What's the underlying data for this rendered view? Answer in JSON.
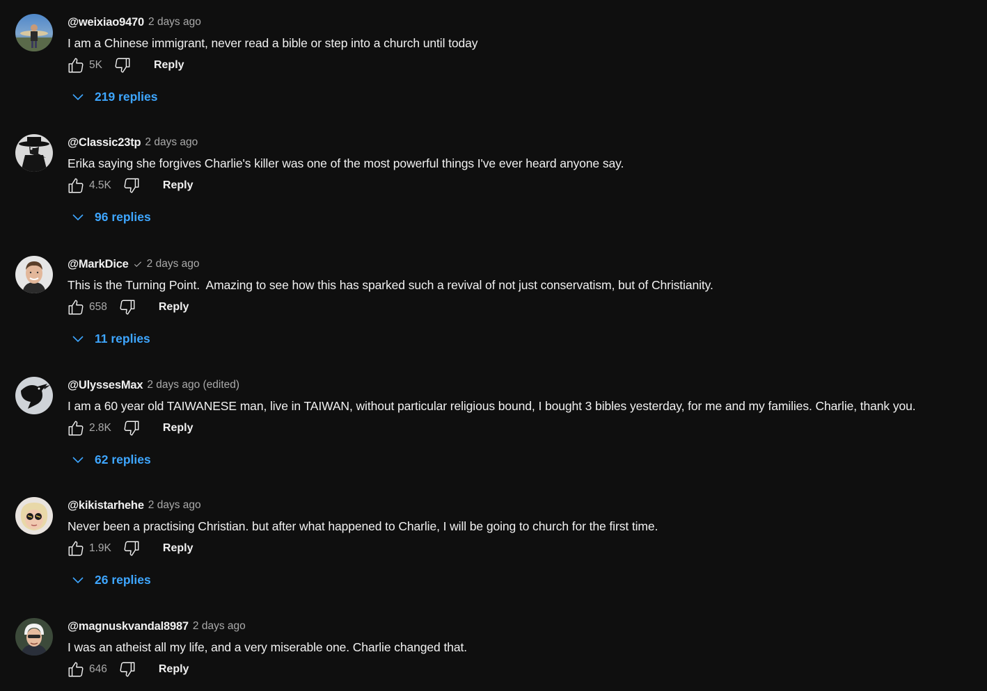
{
  "colors": {
    "background": "#0f0f0f",
    "text": "#f1f1f1",
    "secondary_text": "#aaaaaa",
    "link_blue": "#3ea6ff"
  },
  "comments": [
    {
      "author": "@weixiao9470",
      "time": "2 days ago",
      "verified": false,
      "text": "I am a Chinese immigrant, never read a bible or step into a church until today",
      "likes": "5K",
      "reply_label": "Reply",
      "replies_label": "219 replies",
      "avatar": "fisherman-photo"
    },
    {
      "author": "@Classic23tp",
      "time": "2 days ago",
      "verified": false,
      "text": "Erika saying she forgives Charlie's killer was one of the most powerful things I've ever heard anyone say.",
      "likes": "4.5K",
      "reply_label": "Reply",
      "replies_label": "96 replies",
      "avatar": "plague-doctor-photo"
    },
    {
      "author": "@MarkDice",
      "time": "2 days ago",
      "verified": true,
      "text": "This is the Turning Point.  Amazing to see how this has sparked such a revival of not just conservatism, but of Christianity.",
      "likes": "658",
      "reply_label": "Reply",
      "replies_label": "11 replies",
      "avatar": "man-portrait-photo"
    },
    {
      "author": "@UlyssesMax",
      "time": "2 days ago (edited)",
      "verified": false,
      "text": "I am a 60 year old TAIWANESE man, live in TAIWAN, without particular religious bound, I bought 3 bibles yesterday, for me and my families. Charlie, thank you.",
      "likes": "2.8K",
      "reply_label": "Reply",
      "replies_label": "62 replies",
      "avatar": "crow-photo"
    },
    {
      "author": "@kikistarhehe",
      "time": "2 days ago",
      "verified": false,
      "text": "Never been a practising Christian. but after what happened to Charlie, I will be going to church for the first time.",
      "likes": "1.9K",
      "reply_label": "Reply",
      "replies_label": "26 replies",
      "avatar": "blonde-sunglasses-photo"
    },
    {
      "author": "@magnuskvandal8987",
      "time": "2 days ago",
      "verified": false,
      "text": "I was an atheist all my life, and a very miserable one. Charlie changed that.",
      "likes": "646",
      "reply_label": "Reply",
      "replies_label": "",
      "avatar": "helmet-man-photo"
    }
  ]
}
